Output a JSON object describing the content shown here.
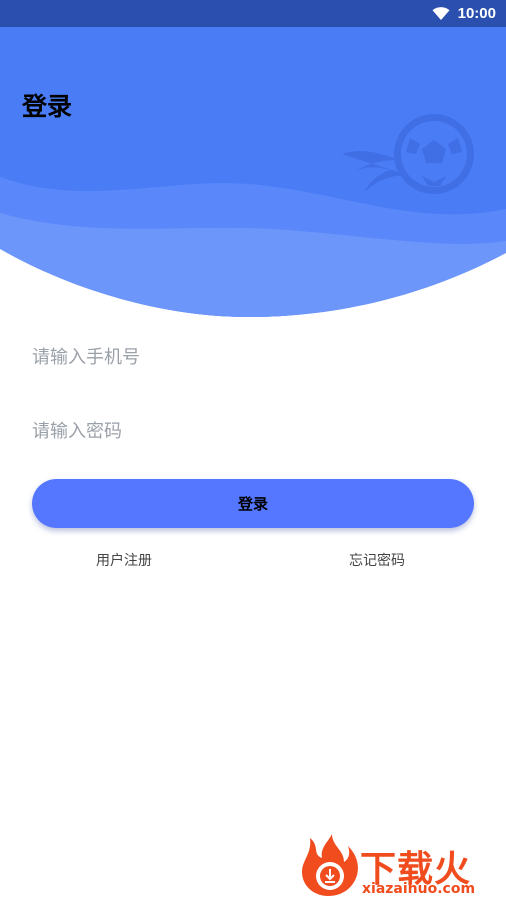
{
  "status_bar": {
    "time": "10:00",
    "wifi_icon": "wifi-icon"
  },
  "header": {
    "title": "登录",
    "illustration_icon": "soccer-ball-icon"
  },
  "form": {
    "phone_placeholder": "请输入手机号",
    "password_placeholder": "请输入密码",
    "login_label": "登录"
  },
  "links": {
    "register": "用户注册",
    "forgot_password": "忘记密码"
  },
  "watermark": {
    "brand": "下载火",
    "url": "xiazaihuo.com"
  },
  "colors": {
    "status_bar": "#2a4fae",
    "header_blue": "#4a7cf6",
    "button": "#5577ff",
    "watermark": "#f04c1e"
  }
}
